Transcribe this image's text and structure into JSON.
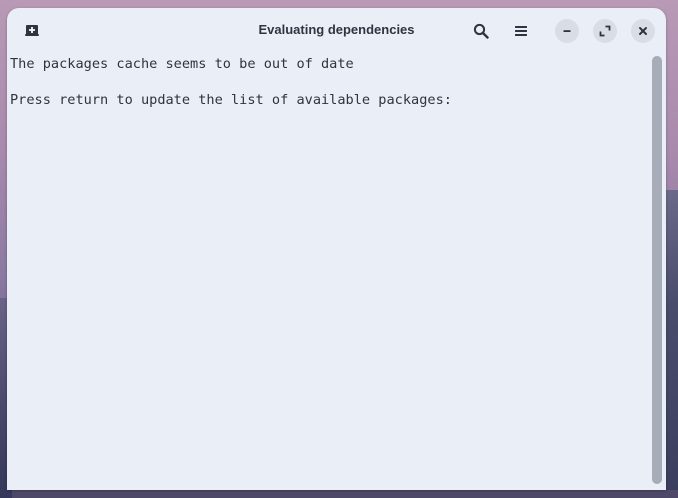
{
  "window": {
    "title": "Evaluating dependencies"
  },
  "titlebar": {
    "new_tab_icon": "new-tab-icon",
    "search_icon": "search-icon",
    "menu_icon": "hamburger-menu-icon",
    "minimize_icon": "minimize-icon",
    "maximize_icon": "maximize-icon",
    "close_icon": "close-icon"
  },
  "terminal": {
    "lines": [
      "The packages cache seems to be out of date",
      "",
      "Press return to update the list of available packages:"
    ]
  },
  "colors": {
    "window_bg": "#eaeff7",
    "text": "#2e3440",
    "button_bg": "#d8dde6"
  }
}
